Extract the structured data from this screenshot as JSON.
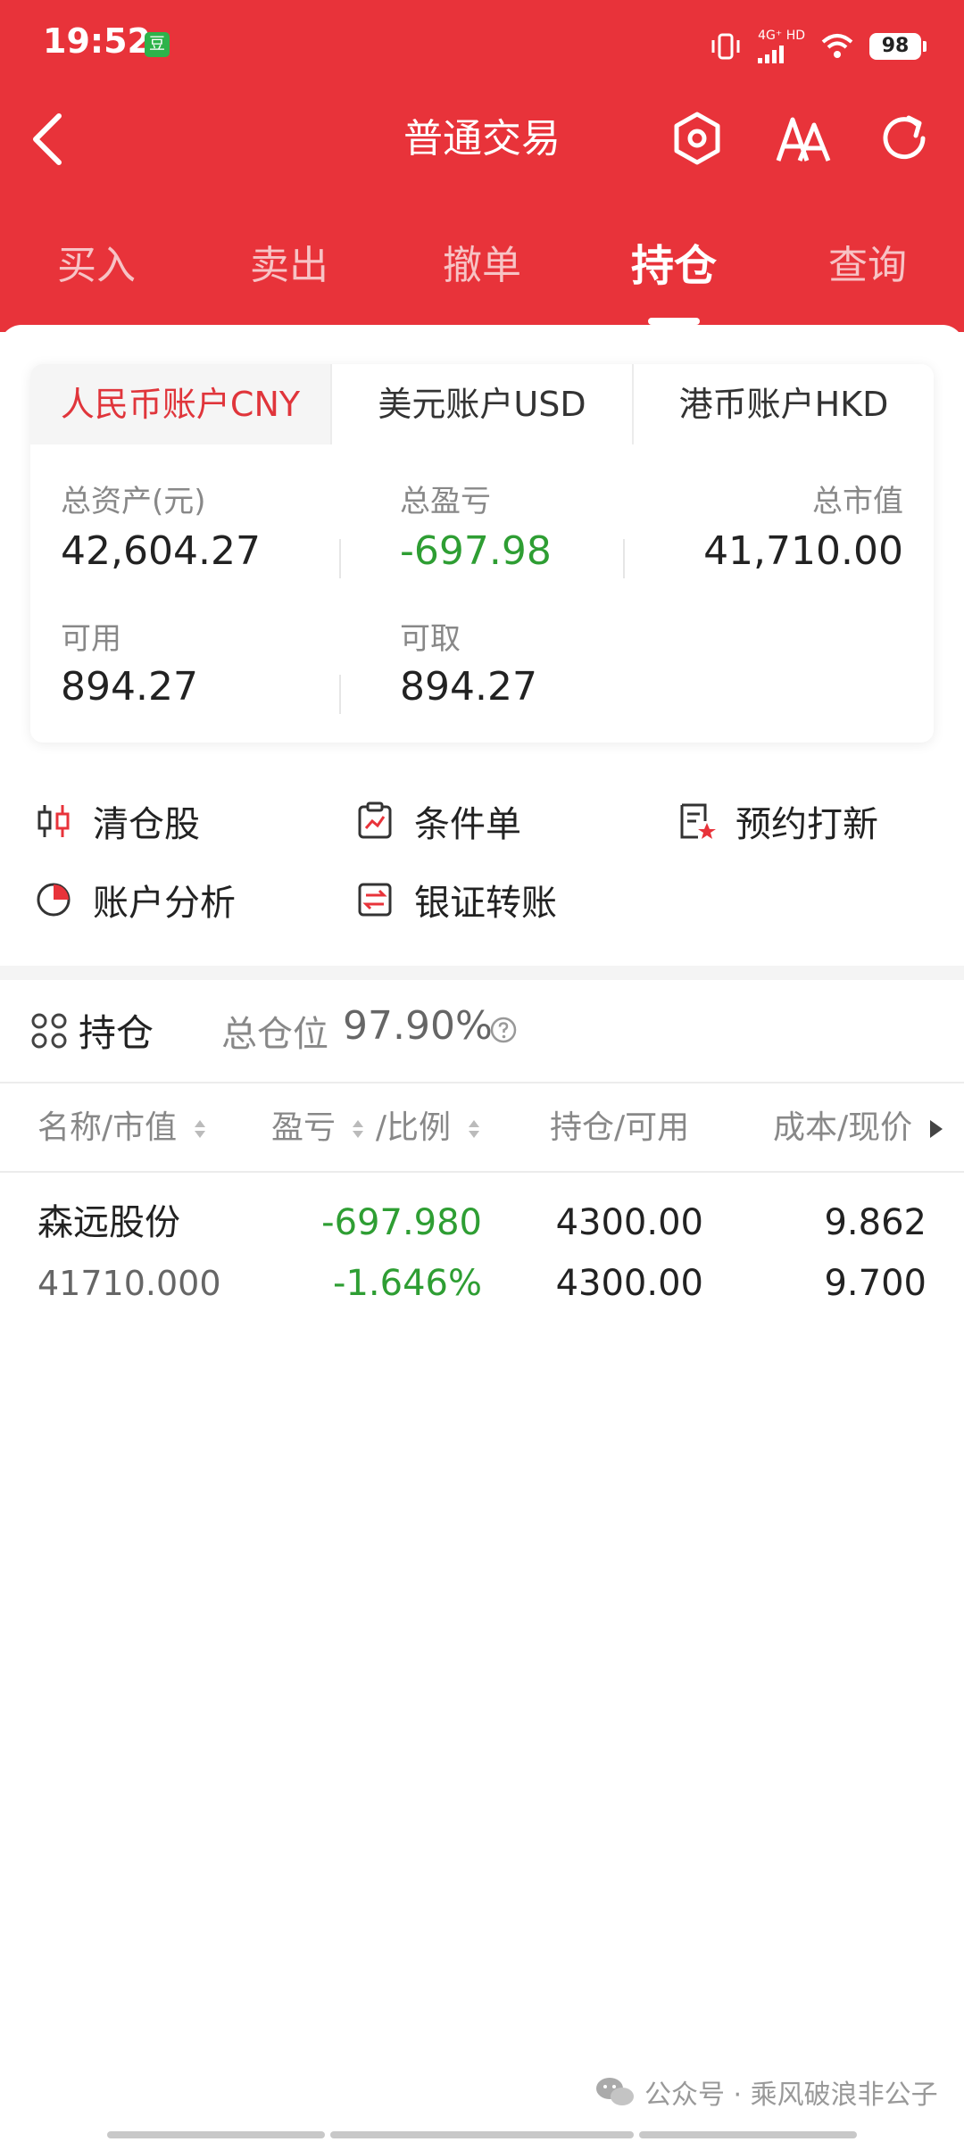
{
  "status": {
    "time": "19:52",
    "app_badge": "豆",
    "network": "4G⁺ HD",
    "battery": "98"
  },
  "header": {
    "title": "普通交易"
  },
  "tabs": [
    {
      "label": "买入"
    },
    {
      "label": "卖出"
    },
    {
      "label": "撤单"
    },
    {
      "label": "持仓"
    },
    {
      "label": "查询"
    }
  ],
  "accounts": {
    "tabs": [
      "人民币账户CNY",
      "美元账户USD",
      "港币账户HKD"
    ],
    "selected_index": 0,
    "total_assets_label": "总资产(元)",
    "total_assets": "42,604.27",
    "total_pnl_label": "总盈亏",
    "total_pnl": "-697.98",
    "market_value_label": "总市值",
    "market_value": "41,710.00",
    "available_label": "可用",
    "available": "894.27",
    "withdrawable_label": "可取",
    "withdrawable": "894.27"
  },
  "quick_actions": [
    {
      "label": "清仓股",
      "icon": "candlestick-icon"
    },
    {
      "label": "条件单",
      "icon": "clipboard-chart-icon"
    },
    {
      "label": "预约打新",
      "icon": "doc-star-icon"
    },
    {
      "label": "账户分析",
      "icon": "pie-chart-icon"
    },
    {
      "label": "银证转账",
      "icon": "transfer-icon"
    }
  ],
  "holdings": {
    "title": "持仓",
    "position_label": "总仓位",
    "position_value": "97.90%",
    "columns": [
      "名称/市值",
      "盈亏",
      "/比例",
      "持仓/可用",
      "成本/现价"
    ],
    "rows": [
      {
        "name": "森远股份",
        "market_value": "41710.000",
        "pnl": "-697.980",
        "pnl_ratio": "-1.646%",
        "holding": "4300.00",
        "available": "4300.00",
        "cost": "9.862",
        "price": "9.700"
      }
    ]
  },
  "watermark": {
    "text": "公众号 · 乘风破浪非公子"
  },
  "colors": {
    "brand_red": "#e8333a",
    "loss_green": "#2e9e33"
  }
}
